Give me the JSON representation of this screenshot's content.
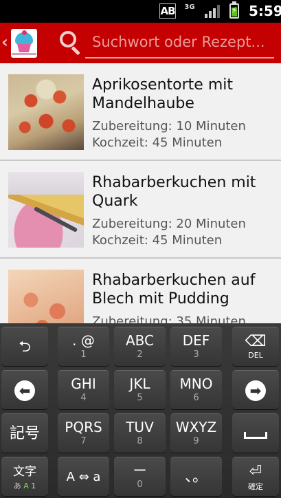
{
  "status_bar": {
    "ime_indicator": "AB",
    "network_type": "3G",
    "signal_level": 0.6,
    "battery_level": 0.65,
    "time": "5:59"
  },
  "action_bar": {
    "background_color": "#c40000",
    "up_glyph": "‹",
    "logo_icon": "cupcake-logo-icon",
    "search_icon": "search-icon",
    "search_placeholder": "Suchwort oder Rezept..."
  },
  "recipes": [
    {
      "title": "Aprikosentorte mit Mandelhaube",
      "prep": "Zubereitung: 10 Minuten",
      "cook": "Kochzeit: 45 Minuten"
    },
    {
      "title": "Rhabarberkuchen mit Quark",
      "prep": "Zubereitung: 20 Minuten",
      "cook": "Kochzeit: 45 Minuten"
    },
    {
      "title": "Rhabarberkuchen auf Blech mit Pudding",
      "prep": "Zubereitung: 35 Minuten",
      "cook": ""
    }
  ],
  "keyboard": {
    "row1": {
      "undo": "⮌",
      "k1": {
        "main": ". @",
        "sub": "1"
      },
      "k2": {
        "main": "ABC",
        "sub": "2"
      },
      "k3": {
        "main": "DEF",
        "sub": "3"
      },
      "del": {
        "glyph": "⌫",
        "label": "DEL"
      }
    },
    "row2": {
      "left": "⬅",
      "k4": {
        "main": "GHI",
        "sub": "4"
      },
      "k5": {
        "main": "JKL",
        "sub": "5"
      },
      "k6": {
        "main": "MNO",
        "sub": "6"
      },
      "right": "➡"
    },
    "row3": {
      "symbols": "記号",
      "k7": {
        "main": "PQRS",
        "sub": "7"
      },
      "k8": {
        "main": "TUV",
        "sub": "8"
      },
      "k9": {
        "main": "WXYZ",
        "sub": "9"
      },
      "space": "space-icon"
    },
    "row4": {
      "mode": {
        "main": "文字",
        "sub_a": "あ",
        "sub_b": "A",
        "sub_c": "1"
      },
      "case": "A ⇔ a",
      "k0": {
        "main": "ー",
        "sub": "0"
      },
      "punct": "、。",
      "confirm": {
        "glyph": "⏎",
        "label": "確定"
      }
    }
  }
}
